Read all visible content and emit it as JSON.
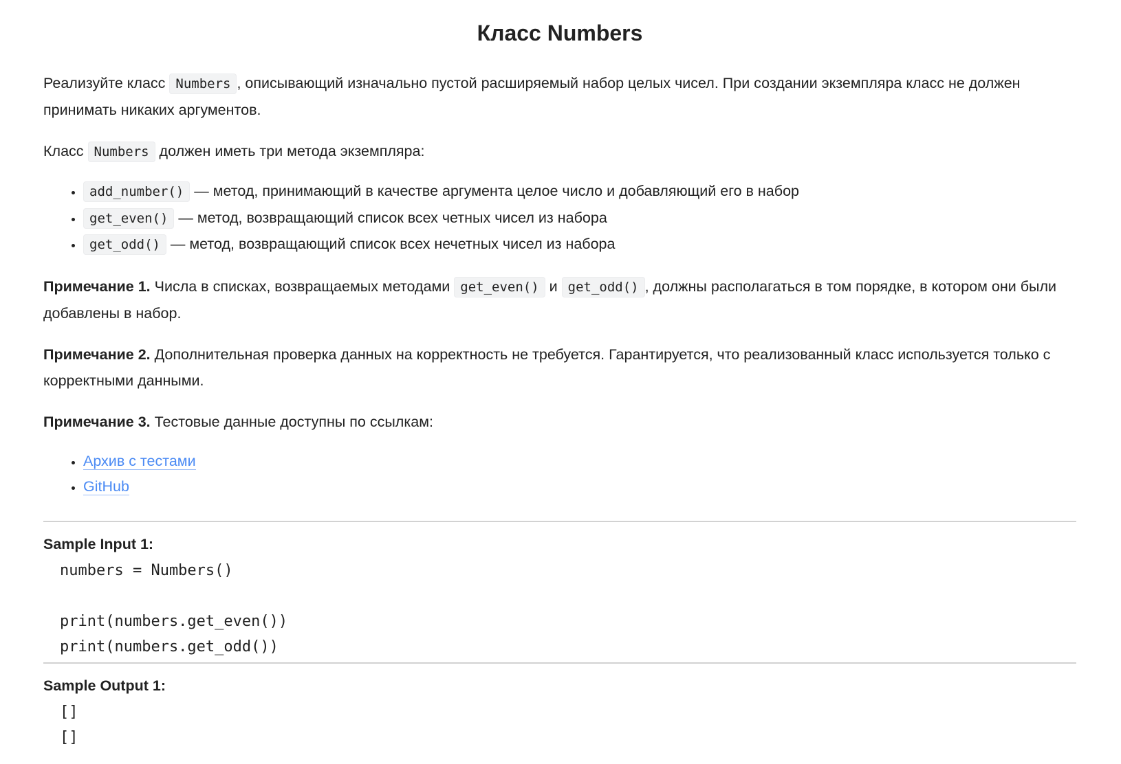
{
  "title": "Класс Numbers",
  "intro": {
    "before": "Реализуйте класс ",
    "code": "Numbers",
    "after": ", описывающий изначально пустой расширяемый набор целых чисел. При создании экземпляра класс не должен принимать никаких аргументов."
  },
  "methods_intro": {
    "before": "Класс ",
    "code": "Numbers",
    "after": " должен иметь три метода экземпляра:"
  },
  "methods": [
    {
      "code": "add_number()",
      "text": " — метод, принимающий в качестве аргумента целое число и добавляющий его в набор"
    },
    {
      "code": "get_even()",
      "text": " — метод, возвращающий список всех четных чисел из набора"
    },
    {
      "code": "get_odd()",
      "text": " — метод, возвращающий список всех нечетных чисел из набора"
    }
  ],
  "note1": {
    "label": "Примечание 1.",
    "before": " Числа в списках, возвращаемых методами ",
    "code1": "get_even()",
    "mid": " и ",
    "code2": "get_odd()",
    "after": ", должны располагаться в том порядке, в котором они были добавлены в набор."
  },
  "note2": {
    "label": "Примечание 2.",
    "text": " Дополнительная проверка данных на корректность не требуется. Гарантируется, что реализованный класс используется только с корректными данными."
  },
  "note3": {
    "label": "Примечание 3.",
    "text": " Тестовые данные доступны по ссылкам:"
  },
  "links": [
    "Архив с тестами",
    "GitHub"
  ],
  "sample_input": {
    "label": "Sample Input 1:",
    "code": "numbers = Numbers()\n\nprint(numbers.get_even())\nprint(numbers.get_odd())"
  },
  "sample_output": {
    "label": "Sample Output 1:",
    "code": "[]\n[]"
  }
}
